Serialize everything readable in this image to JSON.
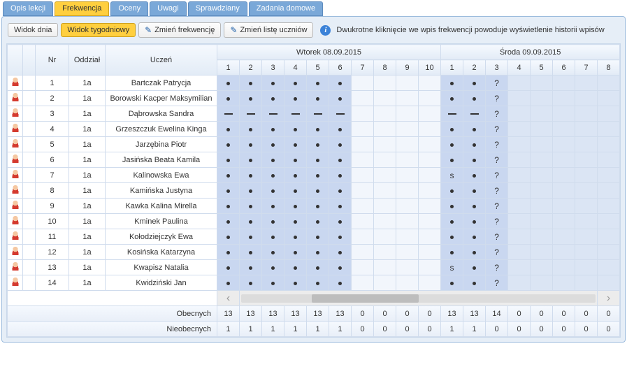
{
  "tabs": {
    "lesson": "Opis lekcji",
    "attendance": "Frekwencja",
    "grades": "Oceny",
    "notes": "Uwagi",
    "tests": "Sprawdziany",
    "homework": "Zadania domowe"
  },
  "toolbar": {
    "day_view": "Widok dnia",
    "week_view": "Widok tygodniowy",
    "change_attendance": "Zmień frekwencję",
    "change_students": "Zmień listę uczniów",
    "info": "Dwukrotne kliknięcie we wpis frekwencji powoduje wyświetlenie historii wpisów"
  },
  "headers": {
    "nr": "Nr",
    "class": "Oddział",
    "student": "Uczeń",
    "day1": "Wtorek 08.09.2015",
    "day2": "Środa 09.09.2015",
    "periods_day1": [
      "1",
      "2",
      "3",
      "4",
      "5",
      "6",
      "7",
      "8",
      "9",
      "10"
    ],
    "periods_day2": [
      "1",
      "2",
      "3",
      "4",
      "5",
      "6",
      "7",
      "8"
    ]
  },
  "rows": [
    {
      "nr": "1",
      "class": "1a",
      "name": "Bartczak Patrycja",
      "d1": [
        "•",
        "•",
        "•",
        "•",
        "•",
        "•",
        "",
        "",
        "",
        ""
      ],
      "d2": [
        "•",
        "•",
        "?",
        "",
        "",
        "",
        "",
        ""
      ]
    },
    {
      "nr": "2",
      "class": "1a",
      "name": "Borowski Kacper Maksymilian",
      "d1": [
        "•",
        "•",
        "•",
        "•",
        "•",
        "•",
        "",
        "",
        "",
        ""
      ],
      "d2": [
        "•",
        "•",
        "?",
        "",
        "",
        "",
        "",
        ""
      ]
    },
    {
      "nr": "3",
      "class": "1a",
      "name": "Dąbrowska Sandra",
      "d1": [
        "—",
        "—",
        "—",
        "—",
        "—",
        "—",
        "",
        "",
        "",
        ""
      ],
      "d2": [
        "—",
        "—",
        "?",
        "",
        "",
        "",
        "",
        ""
      ]
    },
    {
      "nr": "4",
      "class": "1a",
      "name": "Grzeszczuk Ewelina Kinga",
      "d1": [
        "•",
        "•",
        "•",
        "•",
        "•",
        "•",
        "",
        "",
        "",
        ""
      ],
      "d2": [
        "•",
        "•",
        "?",
        "",
        "",
        "",
        "",
        ""
      ]
    },
    {
      "nr": "5",
      "class": "1a",
      "name": "Jarzębina Piotr",
      "d1": [
        "•",
        "•",
        "•",
        "•",
        "•",
        "•",
        "",
        "",
        "",
        ""
      ],
      "d2": [
        "•",
        "•",
        "?",
        "",
        "",
        "",
        "",
        ""
      ]
    },
    {
      "nr": "6",
      "class": "1a",
      "name": "Jasińska Beata Kamila",
      "d1": [
        "•",
        "•",
        "•",
        "•",
        "•",
        "•",
        "",
        "",
        "",
        ""
      ],
      "d2": [
        "•",
        "•",
        "?",
        "",
        "",
        "",
        "",
        ""
      ]
    },
    {
      "nr": "7",
      "class": "1a",
      "name": "Kalinowska Ewa",
      "d1": [
        "•",
        "•",
        "•",
        "•",
        "•",
        "•",
        "",
        "",
        "",
        ""
      ],
      "d2": [
        "s",
        "•",
        "?",
        "",
        "",
        "",
        "",
        ""
      ]
    },
    {
      "nr": "8",
      "class": "1a",
      "name": "Kamińska Justyna",
      "d1": [
        "•",
        "•",
        "•",
        "•",
        "•",
        "•",
        "",
        "",
        "",
        ""
      ],
      "d2": [
        "•",
        "•",
        "?",
        "",
        "",
        "",
        "",
        ""
      ]
    },
    {
      "nr": "9",
      "class": "1a",
      "name": "Kawka Kalina Mirella",
      "d1": [
        "•",
        "•",
        "•",
        "•",
        "•",
        "•",
        "",
        "",
        "",
        ""
      ],
      "d2": [
        "•",
        "•",
        "?",
        "",
        "",
        "",
        "",
        ""
      ]
    },
    {
      "nr": "10",
      "class": "1a",
      "name": "Kminek Paulina",
      "d1": [
        "•",
        "•",
        "•",
        "•",
        "•",
        "•",
        "",
        "",
        "",
        ""
      ],
      "d2": [
        "•",
        "•",
        "?",
        "",
        "",
        "",
        "",
        ""
      ]
    },
    {
      "nr": "11",
      "class": "1a",
      "name": "Kołodziejczyk Ewa",
      "d1": [
        "•",
        "•",
        "•",
        "•",
        "•",
        "•",
        "",
        "",
        "",
        ""
      ],
      "d2": [
        "•",
        "•",
        "?",
        "",
        "",
        "",
        "",
        ""
      ]
    },
    {
      "nr": "12",
      "class": "1a",
      "name": "Kosińska Katarzyna",
      "d1": [
        "•",
        "•",
        "•",
        "•",
        "•",
        "•",
        "",
        "",
        "",
        ""
      ],
      "d2": [
        "•",
        "•",
        "?",
        "",
        "",
        "",
        "",
        ""
      ]
    },
    {
      "nr": "13",
      "class": "1a",
      "name": "Kwapisz Natalia",
      "d1": [
        "•",
        "•",
        "•",
        "•",
        "•",
        "•",
        "",
        "",
        "",
        ""
      ],
      "d2": [
        "s",
        "•",
        "?",
        "",
        "",
        "",
        "",
        ""
      ]
    },
    {
      "nr": "14",
      "class": "1a",
      "name": "Kwidziński Jan",
      "d1": [
        "•",
        "•",
        "•",
        "•",
        "•",
        "•",
        "",
        "",
        "",
        ""
      ],
      "d2": [
        "•",
        "•",
        "?",
        "",
        "",
        "",
        "",
        ""
      ]
    }
  ],
  "footer": {
    "present_label": "Obecnych",
    "absent_label": "Nieobecnych",
    "present": {
      "d1": [
        "13",
        "13",
        "13",
        "13",
        "13",
        "13",
        "0",
        "0",
        "0",
        "0"
      ],
      "d2": [
        "13",
        "13",
        "14",
        "0",
        "0",
        "0",
        "0",
        "0"
      ]
    },
    "absent": {
      "d1": [
        "1",
        "1",
        "1",
        "1",
        "1",
        "1",
        "0",
        "0",
        "0",
        "0"
      ],
      "d2": [
        "1",
        "1",
        "0",
        "0",
        "0",
        "0",
        "0",
        "0"
      ]
    }
  }
}
